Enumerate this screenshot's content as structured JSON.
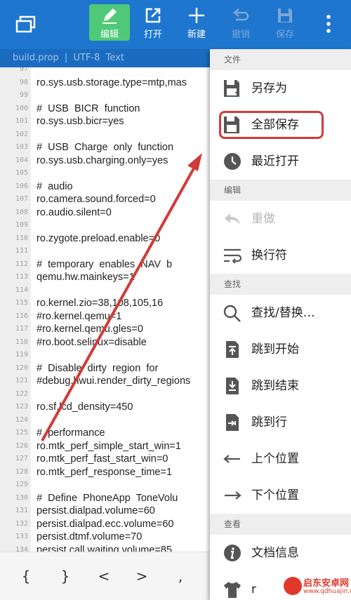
{
  "toolbar": {
    "edit_label": "编辑",
    "open_label": "打开",
    "new_label": "新建",
    "undo_label": "撤销",
    "save_label": "保存",
    "accent_color": "#1e76cf",
    "active_color": "#4fc978"
  },
  "infobar": {
    "text": "build.prop  |  UTF-8  Text"
  },
  "editor": {
    "lines": [
      {
        "num": "97",
        "text": ""
      },
      {
        "num": "98",
        "text": "ro.sys.usb.storage.type=mtp,mas"
      },
      {
        "num": "99",
        "text": ""
      },
      {
        "num": "100",
        "text": "#  USB  BICR  function"
      },
      {
        "num": "101",
        "text": "ro.sys.usb.bicr=yes"
      },
      {
        "num": "102",
        "text": ""
      },
      {
        "num": "103",
        "text": "#  USB  Charge  only  function"
      },
      {
        "num": "104",
        "text": "ro.sys.usb.charging.only=yes"
      },
      {
        "num": "105",
        "text": ""
      },
      {
        "num": "106",
        "text": "#  audio"
      },
      {
        "num": "107",
        "text": "ro.camera.sound.forced=0"
      },
      {
        "num": "108",
        "text": "ro.audio.silent=0"
      },
      {
        "num": "109",
        "text": ""
      },
      {
        "num": "110",
        "text": "ro.zygote.preload.enable=0"
      },
      {
        "num": "111",
        "text": ""
      },
      {
        "num": "112",
        "text": "#  temporary  enables  NAV  b"
      },
      {
        "num": "113",
        "text": "qemu.hw.mainkeys=1"
      },
      {
        "num": "114",
        "text": ""
      },
      {
        "num": "115",
        "text": "ro.kernel.zio=38,108,105,16"
      },
      {
        "num": "116",
        "text": "#ro.kernel.qemu=1"
      },
      {
        "num": "117",
        "text": "#ro.kernel.qemu.gles=0"
      },
      {
        "num": "118",
        "text": "#ro.boot.selinux=disable"
      },
      {
        "num": "119",
        "text": ""
      },
      {
        "num": "120",
        "text": "#  Disable  dirty  region  for"
      },
      {
        "num": "121",
        "text": "#debug.hwui.render_dirty_regions"
      },
      {
        "num": "122",
        "text": ""
      },
      {
        "num": "123",
        "text": "ro.sf.lcd_density=450"
      },
      {
        "num": "124",
        "text": ""
      },
      {
        "num": "125",
        "text": "#  performance"
      },
      {
        "num": "126",
        "text": "ro.mtk_perf_simple_start_win=1"
      },
      {
        "num": "127",
        "text": "ro.mtk_perf_fast_start_win=0"
      },
      {
        "num": "128",
        "text": "ro.mtk_perf_response_time=1"
      },
      {
        "num": "129",
        "text": ""
      },
      {
        "num": "130",
        "text": "#  Define  PhoneApp  ToneVolu"
      },
      {
        "num": "131",
        "text": "persist.dialpad.volume=60"
      },
      {
        "num": "132",
        "text": "persist.dialpad.ecc.volume=60"
      },
      {
        "num": "133",
        "text": "persist.dtmf.volume=70"
      },
      {
        "num": "134",
        "text": "persist.call.waiting.volume=85"
      }
    ]
  },
  "symbols": [
    "{",
    "}",
    "<",
    ">",
    ","
  ],
  "menu": {
    "sections": {
      "file": "文件",
      "edit": "编辑",
      "find": "查找",
      "view": "查看"
    },
    "save_as": "另存为",
    "save_all": "全部保存",
    "recent": "最近打开",
    "redo": "重做",
    "newline": "换行符",
    "find_replace": "查找/替换…",
    "goto_start": "跳到开始",
    "goto_end": "跳到结束",
    "goto_line": "跳到行",
    "prev_pos": "上个位置",
    "next_pos": "下个位置",
    "doc_info": "文档信息",
    "last_partial": "r"
  },
  "annotation": {
    "highlight_color": "#d23a3a"
  },
  "watermark": {
    "title": "启东安卓网",
    "url": "www.qdhuajin.com"
  }
}
